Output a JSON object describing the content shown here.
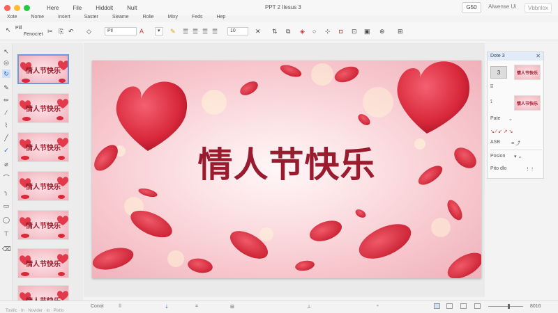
{
  "window": {
    "title": "PPT 2 Ilesus 3",
    "menus": [
      "Here",
      "File",
      "Hiddolt",
      "Nult"
    ],
    "share_label": "G50",
    "account_label": "Alwense Ui",
    "account_extra": "Vbbnlox"
  },
  "ribbon": {
    "tabs": [
      "Xote",
      "Nome",
      "Insert",
      "Saster",
      "Sieame",
      "Rolie",
      "Mixy",
      "Feds",
      "Hep"
    ],
    "paste_label_1": "Pill",
    "paste_label_2": "Fenocret",
    "font_name": "Pil",
    "font_size": "10"
  },
  "thumbnails": {
    "items": [
      {
        "title": "情人节快乐",
        "active": true
      },
      {
        "title": "情人节快乐",
        "active": false
      },
      {
        "title": "情人节快乐",
        "active": false
      },
      {
        "title": "情人节快乐",
        "active": false
      },
      {
        "title": "情人节快乐",
        "active": false
      },
      {
        "title": "情人节快乐",
        "active": false
      },
      {
        "title": "情人节快乐",
        "active": false
      }
    ]
  },
  "slide": {
    "title": "情人节快乐",
    "colors": {
      "title": "#9a1a2e",
      "petal": "#d8283a",
      "heart": "#e23a4a",
      "bg_center": "#fff7f8",
      "bg_edge": "#f0b0ba"
    }
  },
  "right_panel": {
    "title": "Dote 3",
    "number": "3",
    "mini_title": "情人节快乐",
    "row_1": "Pate",
    "row_2": "ASB",
    "section": "Posion",
    "section_2": "Pito dlo"
  },
  "status": {
    "left": "Conot",
    "bottom_note": "Tostilc · In · Novider · Io · Pixtlo",
    "zoom": "8016"
  }
}
